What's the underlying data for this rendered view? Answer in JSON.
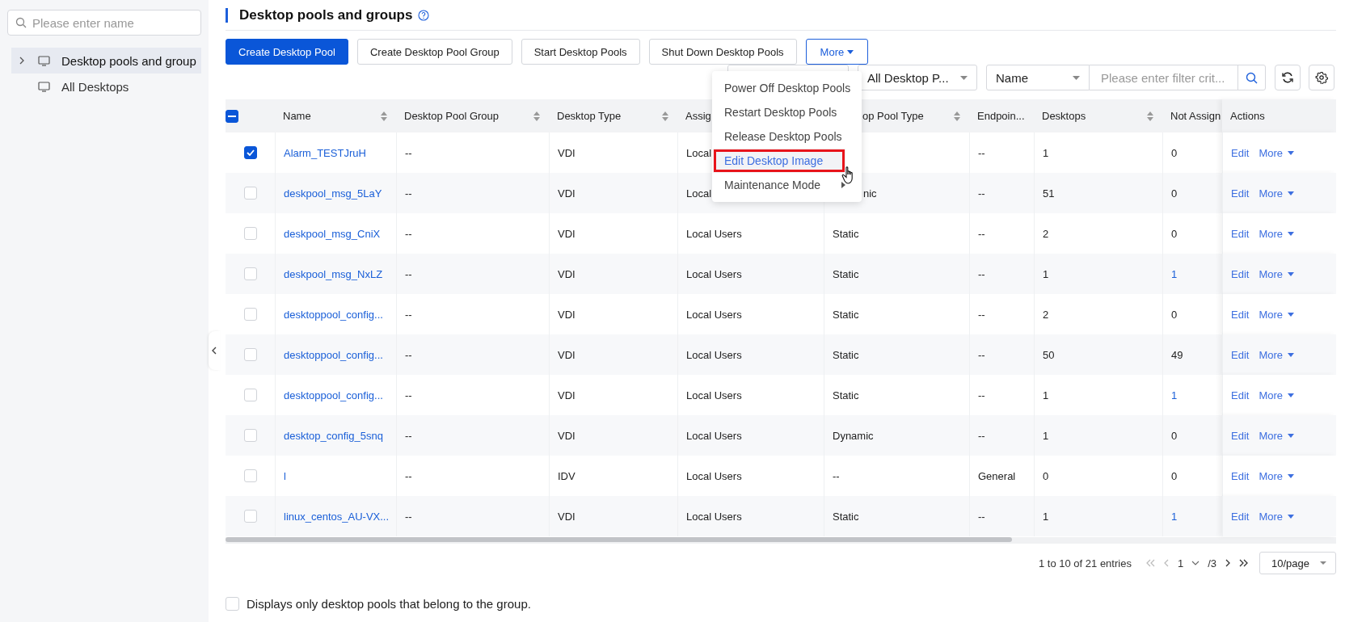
{
  "sidebar": {
    "search": {
      "placeholder": "Please enter name"
    },
    "items": [
      {
        "label": "Desktop pools and group",
        "selected": true,
        "expandable": true
      },
      {
        "label": "All Desktops",
        "selected": false,
        "expandable": false
      }
    ]
  },
  "page": {
    "title": "Desktop pools and groups"
  },
  "toolbar": {
    "buttons": [
      {
        "label": "Create Desktop Pool",
        "kind": "primary"
      },
      {
        "label": "Create Desktop Pool Group",
        "kind": "default"
      },
      {
        "label": "Start Desktop Pools",
        "kind": "default"
      },
      {
        "label": "Shut Down Desktop Pools",
        "kind": "default"
      },
      {
        "label": "More",
        "kind": "dropdown"
      }
    ]
  },
  "more_menu": {
    "items": [
      {
        "label": "Power Off Desktop Pools",
        "selected": false,
        "submenu": false
      },
      {
        "label": "Restart Desktop Pools",
        "selected": false,
        "submenu": false
      },
      {
        "label": "Release Desktop Pools",
        "selected": false,
        "submenu": false
      },
      {
        "label": "Edit Desktop Image",
        "selected": true,
        "submenu": false
      },
      {
        "label": "Maintenance Mode",
        "selected": false,
        "submenu": true
      }
    ]
  },
  "filters": {
    "pool_filter": "All Desktop P...",
    "field_select": "Name",
    "search": {
      "placeholder": "Please enter filter crit..."
    }
  },
  "table": {
    "select_all": {
      "indeterminate": true
    },
    "columns": [
      {
        "label": "Name",
        "sortable": true,
        "kind": "link"
      },
      {
        "label": "Desktop Pool Group",
        "sortable": true,
        "kind": "text"
      },
      {
        "label": "Desktop Type",
        "sortable": true,
        "kind": "text"
      },
      {
        "label": "Assig",
        "sortable": false,
        "kind": "text"
      },
      {
        "label": "op Pool Type",
        "sortable": true,
        "kind": "text"
      },
      {
        "label": "Endpoin...",
        "sortable": false,
        "kind": "text"
      },
      {
        "label": "Desktops",
        "sortable": true,
        "kind": "text"
      },
      {
        "label": "Not Assign",
        "sortable": false,
        "kind": "count"
      },
      {
        "label": "Actions",
        "sortable": false,
        "kind": "actions"
      }
    ],
    "rows": [
      {
        "checked": true,
        "not_assigned_link": false,
        "cells": [
          "Alarm_TESTJruH",
          "--",
          "VDI",
          "Local",
          null,
          "--",
          "1",
          "0"
        ],
        "actions": [
          "Edit",
          "More"
        ]
      },
      {
        "checked": false,
        "not_assigned_link": false,
        "cells": [
          "deskpool_msg_5LaY",
          "--",
          "VDI",
          "Local",
          "nic",
          "--",
          "51",
          "0"
        ],
        "actions": [
          "Edit",
          "More"
        ]
      },
      {
        "checked": false,
        "not_assigned_link": false,
        "cells": [
          "deskpool_msg_CniX",
          "--",
          "VDI",
          "Local Users",
          "Static",
          "--",
          "2",
          "0"
        ],
        "actions": [
          "Edit",
          "More"
        ]
      },
      {
        "checked": false,
        "not_assigned_link": true,
        "cells": [
          "deskpool_msg_NxLZ",
          "--",
          "VDI",
          "Local Users",
          "Static",
          "--",
          "1",
          "1"
        ],
        "actions": [
          "Edit",
          "More"
        ]
      },
      {
        "checked": false,
        "not_assigned_link": false,
        "cells": [
          "desktoppool_config...",
          "--",
          "VDI",
          "Local Users",
          "Static",
          "--",
          "2",
          "0"
        ],
        "actions": [
          "Edit",
          "More"
        ]
      },
      {
        "checked": false,
        "not_assigned_link": false,
        "cells": [
          "desktoppool_config...",
          "--",
          "VDI",
          "Local Users",
          "Static",
          "--",
          "50",
          "49"
        ],
        "actions": [
          "Edit",
          "More"
        ]
      },
      {
        "checked": false,
        "not_assigned_link": true,
        "cells": [
          "desktoppool_config...",
          "--",
          "VDI",
          "Local Users",
          "Static",
          "--",
          "1",
          "1"
        ],
        "actions": [
          "Edit",
          "More"
        ]
      },
      {
        "checked": false,
        "not_assigned_link": false,
        "cells": [
          "desktop_config_5snq",
          "--",
          "VDI",
          "Local Users",
          "Dynamic",
          "--",
          "1",
          "0"
        ],
        "actions": [
          "Edit",
          "More"
        ]
      },
      {
        "checked": false,
        "not_assigned_link": false,
        "cells": [
          "l",
          "--",
          "IDV",
          "Local Users",
          "--",
          "General",
          "0",
          "0"
        ],
        "actions": [
          "Edit",
          "More"
        ]
      },
      {
        "checked": false,
        "not_assigned_link": true,
        "cells": [
          "linux_centos_AU-VX...",
          "--",
          "VDI",
          "Local Users",
          "Static",
          "--",
          "1",
          "1"
        ],
        "actions": [
          "Edit",
          "More"
        ]
      }
    ]
  },
  "pagination": {
    "summary": "1 to 10 of 21 entries",
    "page": "1",
    "total": "/3",
    "page_size": "10/page"
  },
  "footer": {
    "label": "Displays only desktop pools that belong to the group.",
    "checked": false
  }
}
